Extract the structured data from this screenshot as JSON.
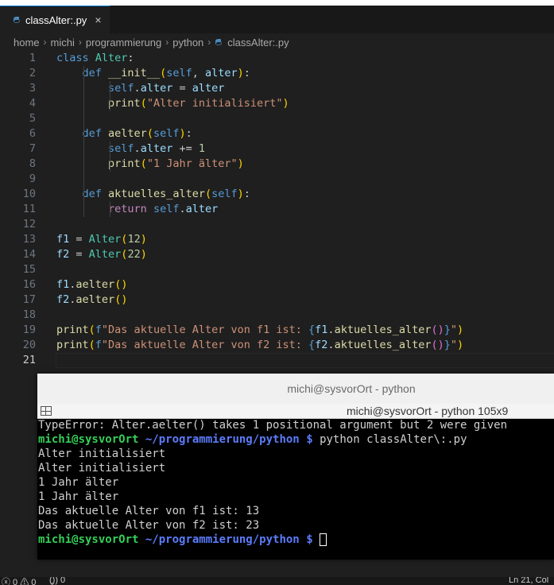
{
  "tab": {
    "label": "classAlter:.py",
    "close_glyph": "×"
  },
  "breadcrumb": {
    "items": [
      "home",
      "michi",
      "programmierung",
      "python",
      "classAlter:.py"
    ]
  },
  "editor": {
    "lines": [
      {
        "n": "1",
        "html": "<span class='kw'>class</span> <span class='cls'>Alter</span><span class='plain'>:</span>"
      },
      {
        "n": "2",
        "html": "    <span class='kw'>def</span> <span class='fn'>__init__</span><span class='paren'>(</span><span class='self'>self</span>, <span class='var'>alter</span><span class='paren'>)</span>:"
      },
      {
        "n": "3",
        "html": "        <span class='self'>self</span>.<span class='var'>alter</span> = <span class='var'>alter</span>"
      },
      {
        "n": "4",
        "html": "        <span class='fn'>print</span><span class='paren'>(</span><span class='str'>\"Alter initialisiert\"</span><span class='paren'>)</span>"
      },
      {
        "n": "5",
        "html": ""
      },
      {
        "n": "6",
        "html": "    <span class='kw'>def</span> <span class='fn'>aelter</span><span class='paren'>(</span><span class='self'>self</span><span class='paren'>)</span>:"
      },
      {
        "n": "7",
        "html": "        <span class='self'>self</span>.<span class='var'>alter</span> += <span class='num'>1</span>"
      },
      {
        "n": "8",
        "html": "        <span class='fn'>print</span><span class='paren'>(</span><span class='str'>\"1 Jahr älter\"</span><span class='paren'>)</span>"
      },
      {
        "n": "9",
        "html": ""
      },
      {
        "n": "10",
        "html": "    <span class='kw'>def</span> <span class='fn'>aktuelles_alter</span><span class='paren'>(</span><span class='self'>self</span><span class='paren'>)</span>:"
      },
      {
        "n": "11",
        "html": "        <span class='ret'>return</span> <span class='self'>self</span>.<span class='var'>alter</span>"
      },
      {
        "n": "12",
        "html": ""
      },
      {
        "n": "13",
        "html": "<span class='var'>f1</span> = <span class='cls'>Alter</span><span class='paren'>(</span><span class='num'>12</span><span class='paren'>)</span>"
      },
      {
        "n": "14",
        "html": "<span class='var'>f2</span> = <span class='cls'>Alter</span><span class='paren'>(</span><span class='num'>22</span><span class='paren'>)</span>"
      },
      {
        "n": "15",
        "html": ""
      },
      {
        "n": "16",
        "html": "<span class='var'>f1</span>.<span class='fn'>aelter</span><span class='paren'>()</span>"
      },
      {
        "n": "17",
        "html": "<span class='var'>f2</span>.<span class='fn'>aelter</span><span class='paren'>()</span>"
      },
      {
        "n": "18",
        "html": ""
      },
      {
        "n": "19",
        "html": "<span class='fn'>print</span><span class='paren'>(</span><span class='kw'>f</span><span class='str'>\"Das aktuelle Alter von f1 ist: </span><span class='brace'>{</span><span class='var'>f1</span>.<span class='fn'>aktuelles_alter</span><span class='paren2'>()</span><span class='brace'>}</span><span class='str'>\"</span><span class='paren'>)</span>"
      },
      {
        "n": "20",
        "html": "<span class='fn'>print</span><span class='paren'>(</span><span class='kw'>f</span><span class='str'>\"Das aktuelle Alter von f2 ist: </span><span class='brace'>{</span><span class='var'>f2</span>.<span class='fn'>aktuelles_alter</span><span class='paren2'>()</span><span class='brace'>}</span><span class='str'>\"</span><span class='paren'>)</span>"
      },
      {
        "n": "21",
        "html": ""
      }
    ]
  },
  "terminal": {
    "window_title": "michi@sysvorOrt - python",
    "tab_title": "michi@sysvorOrt - python 105x9",
    "error_line": "TypeError: Alter.aelter() takes 1 positional argument but 2 were given",
    "prompt_user": "michi@sysvorOrt",
    "prompt_path": "~/programmierung/python",
    "prompt_symbol": "$",
    "command": "python classAlter\\:.py",
    "output": [
      "Alter initialisiert",
      "Alter initialisiert",
      "1 Jahr älter",
      "1 Jahr älter",
      "Das aktuelle Alter von f1 ist: 13",
      "Das aktuelle Alter von f2 ist: 23"
    ]
  },
  "statusbar": {
    "problems": "ⓧ 0 ⚠ 0",
    "ports": "(̧̧)) 0",
    "position": "Ln 21, Col"
  },
  "colors": {
    "accent": "#0078d4",
    "prompt_user": "#34d058",
    "prompt_path": "#5c7cfa"
  }
}
